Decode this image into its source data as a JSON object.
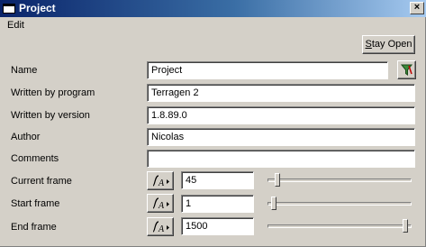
{
  "window": {
    "title": "Project",
    "close_glyph": "×"
  },
  "menu": {
    "items": [
      {
        "label": "Edit"
      }
    ]
  },
  "toolbar": {
    "stay_open_label": "Stay Open"
  },
  "form": {
    "name": {
      "label": "Name",
      "value": "Project"
    },
    "written_program": {
      "label": "Written by program",
      "value": "Terragen 2"
    },
    "written_version": {
      "label": "Written by version",
      "value": "1.8.89.0"
    },
    "author": {
      "label": "Author",
      "value": "Nicolas"
    },
    "comments": {
      "label": "Comments",
      "value": ""
    }
  },
  "frames": {
    "current": {
      "label": "Current frame",
      "value": "45",
      "slider_fraction": 0.03
    },
    "start": {
      "label": "Start frame",
      "value": "1",
      "slider_fraction": 0.0
    },
    "end": {
      "label": "End frame",
      "value": "1500",
      "slider_fraction": 1.0
    }
  },
  "icons": {
    "filter": "filter-icon",
    "animate": "animation-curve-icon",
    "app": "window-icon"
  },
  "colors": {
    "titlebar_start": "#0a246a",
    "titlebar_end": "#a6caf0",
    "face": "#d4d0c8"
  }
}
